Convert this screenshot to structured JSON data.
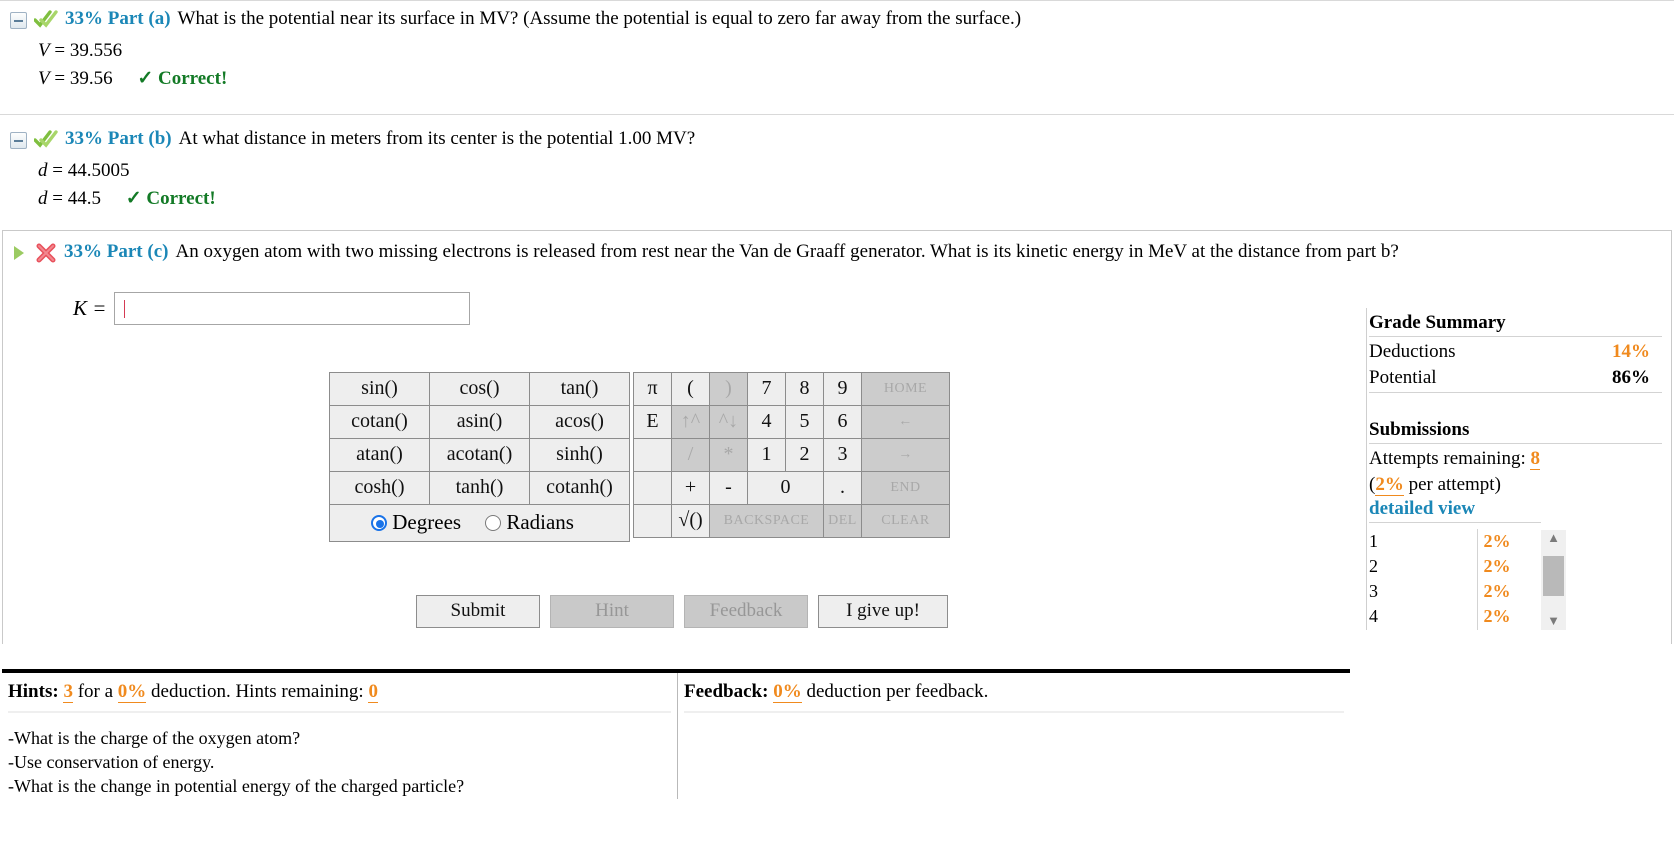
{
  "parts": [
    {
      "icon_toggle": "collapse-icon",
      "status_icon": "green-double-check-icon",
      "weight": "33% Part (a)",
      "question": "What is the potential near its surface in MV? (Assume the potential is equal to zero far away from the surface.)",
      "var": "V",
      "entered": "39.556",
      "graded": "39.56",
      "result": "Correct!",
      "check": "✓"
    },
    {
      "icon_toggle": "collapse-icon",
      "status_icon": "green-double-check-icon",
      "weight": "33% Part (b)",
      "question": "At what distance in meters from its center is the potential 1.00 MV?",
      "var": "d",
      "entered": "44.5005",
      "graded": "44.5",
      "result": "Correct!",
      "check": "✓"
    }
  ],
  "active_part": {
    "icon_toggle": "expand-triangle-icon",
    "status_icon": "red-x-icon",
    "weight": "33% Part (c)",
    "question": "An oxygen atom with two missing electrons is released from rest near the Van de Graaff generator. What is its kinetic energy in MeV at the distance from part b?",
    "var_label": "K =",
    "input_value": "",
    "input_placeholder": ""
  },
  "calculator": {
    "functions": [
      [
        "sin()",
        "cos()",
        "tan()"
      ],
      [
        "cotan()",
        "asin()",
        "acos()"
      ],
      [
        "atan()",
        "acotan()",
        "sinh()"
      ],
      [
        "cosh()",
        "tanh()",
        "cotanh()"
      ]
    ],
    "angle_mode": {
      "degrees_label": "Degrees",
      "radians_label": "Radians",
      "selected": "Degrees"
    },
    "keypad": [
      [
        {
          "label": "π",
          "disabled": false
        },
        {
          "label": "(",
          "disabled": false
        },
        {
          "label": ")",
          "disabled": true
        },
        {
          "label": "7",
          "disabled": false
        },
        {
          "label": "8",
          "disabled": false
        },
        {
          "label": "9",
          "disabled": false
        },
        {
          "label": "HOME",
          "disabled": true,
          "small": true
        }
      ],
      [
        {
          "label": "E",
          "disabled": false
        },
        {
          "label": "↑^",
          "disabled": true
        },
        {
          "label": "^↓",
          "disabled": true
        },
        {
          "label": "4",
          "disabled": false
        },
        {
          "label": "5",
          "disabled": false
        },
        {
          "label": "6",
          "disabled": false
        },
        {
          "label": "←",
          "disabled": true,
          "small": true
        }
      ],
      [
        {
          "label": "",
          "disabled": false
        },
        {
          "label": "/",
          "disabled": true
        },
        {
          "label": "*",
          "disabled": true
        },
        {
          "label": "1",
          "disabled": false
        },
        {
          "label": "2",
          "disabled": false
        },
        {
          "label": "3",
          "disabled": false
        },
        {
          "label": "→",
          "disabled": true,
          "small": true
        }
      ],
      [
        {
          "label": "",
          "disabled": false
        },
        {
          "label": "+",
          "disabled": false
        },
        {
          "label": "-",
          "disabled": false
        },
        {
          "label": "0",
          "disabled": false,
          "wide": true
        },
        {
          "label": ".",
          "disabled": false
        },
        {
          "label": "END",
          "disabled": true,
          "small": true
        }
      ],
      [
        {
          "label": "",
          "disabled": false
        },
        {
          "label": "√()",
          "disabled": false
        },
        {
          "label": "BACKSPACE",
          "disabled": true,
          "small": true
        },
        {
          "label": "DEL",
          "disabled": true,
          "small": true
        },
        {
          "label": "CLEAR",
          "disabled": true,
          "small": true
        }
      ]
    ]
  },
  "buttons": {
    "submit": "Submit",
    "hint": "Hint",
    "feedback": "Feedback",
    "give_up": "I give up!"
  },
  "grade_summary": {
    "title": "Grade Summary",
    "rows": [
      {
        "label": "Deductions",
        "value": "14%",
        "accent": true
      },
      {
        "label": "Potential",
        "value": "86%",
        "accent": false
      }
    ],
    "submissions_title": "Submissions",
    "attempts_label": "Attempts remaining:",
    "attempts_value": "8",
    "per_attempt_open": "(",
    "per_attempt_value": "2%",
    "per_attempt_text": " per attempt)",
    "detailed_view": "detailed view",
    "table": [
      {
        "n": "1",
        "pct": "2%"
      },
      {
        "n": "2",
        "pct": "2%"
      },
      {
        "n": "3",
        "pct": "2%"
      },
      {
        "n": "4",
        "pct": "2%"
      }
    ],
    "scroll_up": "▲",
    "scroll_down": "▼"
  },
  "hints": {
    "title": "Hints:",
    "count": "3",
    "for_a": "for a",
    "deduction_pct": "0%",
    "deduction_text": "deduction. Hints remaining:",
    "remaining": "0",
    "items": [
      "-What is the charge of the oxygen atom?",
      "-Use conservation of energy.",
      "-What is the change in potential energy of the charged particle?"
    ]
  },
  "feedback": {
    "title": "Feedback:",
    "deduction_pct": "0%",
    "text": "deduction per feedback."
  },
  "colors": {
    "accent_orange": "#f08a1e",
    "link_blue": "#1b87b7",
    "correct_green": "#137a26",
    "error_red": "#e04a4a"
  }
}
